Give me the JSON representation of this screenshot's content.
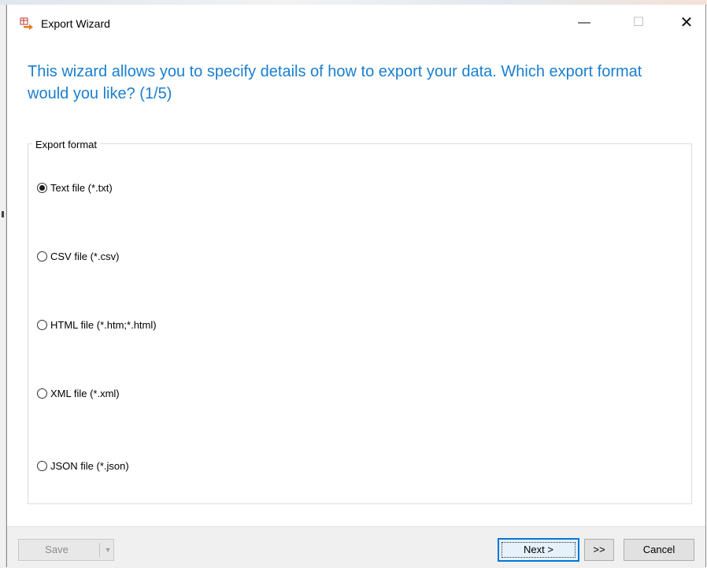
{
  "window": {
    "title": "Export Wizard",
    "icon": "export-wizard-app-icon",
    "controls": {
      "minimize": "—",
      "maximize": "☐",
      "close": "✕"
    }
  },
  "heading": "This wizard allows you to specify details of how to export your data. Which export format would you like? (1/5)",
  "export_format": {
    "legend": "Export format",
    "selected": "Text file (*.txt)",
    "options": [
      {
        "label": "Text file (*.txt)",
        "checked": true
      },
      {
        "label": "CSV file (*.csv)",
        "checked": false
      },
      {
        "label": "HTML file (*.htm;*.html)",
        "checked": false
      },
      {
        "label": "XML file (*.xml)",
        "checked": false
      },
      {
        "label": "JSON file (*.json)",
        "checked": false
      }
    ]
  },
  "footer": {
    "save_label": "Save",
    "save_enabled": false,
    "next_label": "Next >",
    "skip_label": ">>",
    "cancel_label": "Cancel"
  },
  "colors": {
    "heading": "#1a7fd0",
    "default_button_border": "#0078d7",
    "footer_bg": "#f0f0f0"
  }
}
